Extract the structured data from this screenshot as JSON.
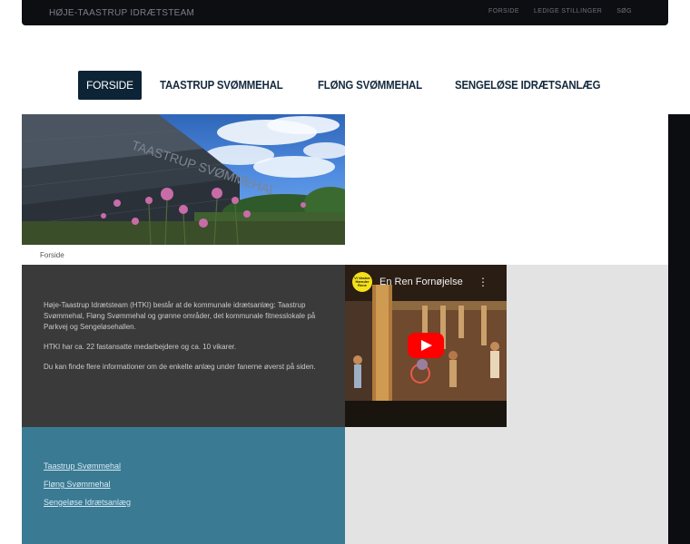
{
  "header": {
    "site_title": "HØJE-TAASTRUP IDRÆTSTEAM",
    "links": [
      "FORSIDE",
      "LEDIGE STILLINGER",
      "SØG"
    ]
  },
  "nav": {
    "items": [
      {
        "label": "FORSIDE",
        "active": true
      },
      {
        "label": "TAASTRUP SVØMMEHAL",
        "active": false
      },
      {
        "label": "FLØNG SVØMMEHAL",
        "active": false
      },
      {
        "label": "SENGELØSE IDRÆTSANLÆG",
        "active": false
      }
    ]
  },
  "hero": {
    "caption": "Forside",
    "building_sign": "TAASTRUP SVØMMEHAL"
  },
  "info": {
    "paragraphs": [
      "Høje-Taastrup Idrætsteam (HTKI) består at de kommunale idrætsanlæg: Taastrup Svømmehal, Fløng Svømmehal og grønne områder, det kommunale fitnesslokale på Parkvej og Sengeløsehallen.",
      "HTKI har ca. 22 fastansatte medarbejdere og ca. 10 vikarer.",
      "Du kan finde flere informationer om de enkelte anlæg under fanerne øverst på siden."
    ]
  },
  "video": {
    "title": "En Ren Fornøjelse",
    "logo_text": "Vi Vasker Hænder Rene",
    "menu_glyph": "⋮"
  },
  "links": [
    "Taastrup Svømmehal",
    "Fløng Svømmehal",
    "Sengeløse Idrætsanlæg"
  ],
  "colors": {
    "top_bar": "#0d0e12",
    "nav_active": "#0d2336",
    "info_panel": "#3a3a3b",
    "links_panel": "#3b7a93",
    "play_button": "#ff0000"
  }
}
